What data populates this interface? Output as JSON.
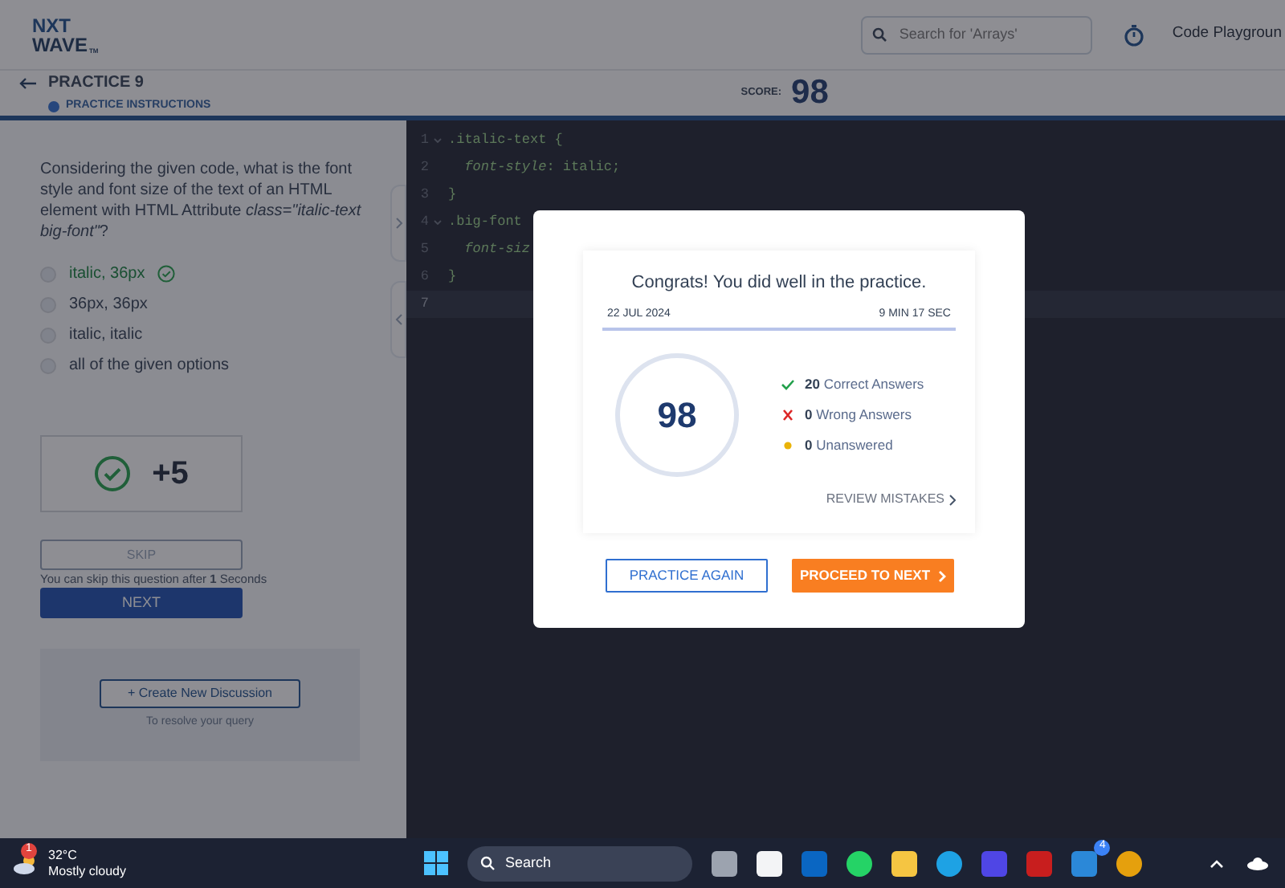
{
  "header": {
    "logo_top": "NXT",
    "logo_bottom": "WAVE",
    "logo_mark": "TM",
    "search": {
      "placeholder": "Search for 'Arrays'"
    },
    "link": "Code Playgroun"
  },
  "practice": {
    "title": "PRACTICE 9",
    "instructions": "PRACTICE INSTRUCTIONS",
    "score_label": "SCORE:",
    "score": "98"
  },
  "question": {
    "text": "Considering the given code, what is the font style and font size of the text of an HTML element with HTML Attribute *class=\"italic-text big-font\"*?",
    "options": [
      {
        "label": "italic, 36px",
        "correct": true,
        "selected": false
      },
      {
        "label": "36px, 36px",
        "correct": false,
        "selected": false
      },
      {
        "label": "italic, italic",
        "correct": false,
        "selected": false
      },
      {
        "label": "all of the given options",
        "correct": false,
        "selected": false
      }
    ],
    "result": {
      "points": "+5",
      "correct": true
    },
    "skip_button": "SKIP",
    "skip_note": "You can skip this question after **1** Seconds",
    "next_button": "NEXT",
    "discussion": {
      "button": "+ Create New Discussion",
      "note": "To resolve your query"
    }
  },
  "editor": {
    "lines": [
      {
        "number": "1",
        "code": ".italic-text {",
        "foldable": true,
        "active": false
      },
      {
        "number": "2",
        "code": "  *font-style*: italic;",
        "foldable": false,
        "active": false
      },
      {
        "number": "3",
        "code": "}",
        "foldable": false,
        "active": false
      },
      {
        "number": "4",
        "code": ".big-font",
        "foldable": true,
        "active": false
      },
      {
        "number": "5",
        "code": "  *font-siz*",
        "foldable": false,
        "active": false
      },
      {
        "number": "6",
        "code": "}",
        "foldable": false,
        "active": false
      },
      {
        "number": "7",
        "foldable": false,
        "active": true
      }
    ]
  },
  "modal": {
    "title": "Congrats! You did well in the practice.",
    "date": "22 JUL 2024",
    "duration": "9 MIN 17 SEC",
    "score": "98",
    "stats": [
      {
        "kind": "correct",
        "count": "20",
        "label": "Correct Answers"
      },
      {
        "kind": "wrong",
        "count": "0",
        "label": "Wrong Answers"
      },
      {
        "kind": "unanswered",
        "count": "0",
        "label": "Unanswered"
      }
    ],
    "review_link": "REVIEW MISTAKES",
    "buttons": [
      {
        "label": "PRACTICE AGAIN",
        "kind": "outline"
      },
      {
        "label": "PROCEED TO NEXT",
        "kind": "primary"
      }
    ]
  },
  "taskbar": {
    "weather": {
      "temperature": "32°C",
      "condition": "Mostly cloudy",
      "badge": "1"
    },
    "search": "Search",
    "badge": "4"
  }
}
